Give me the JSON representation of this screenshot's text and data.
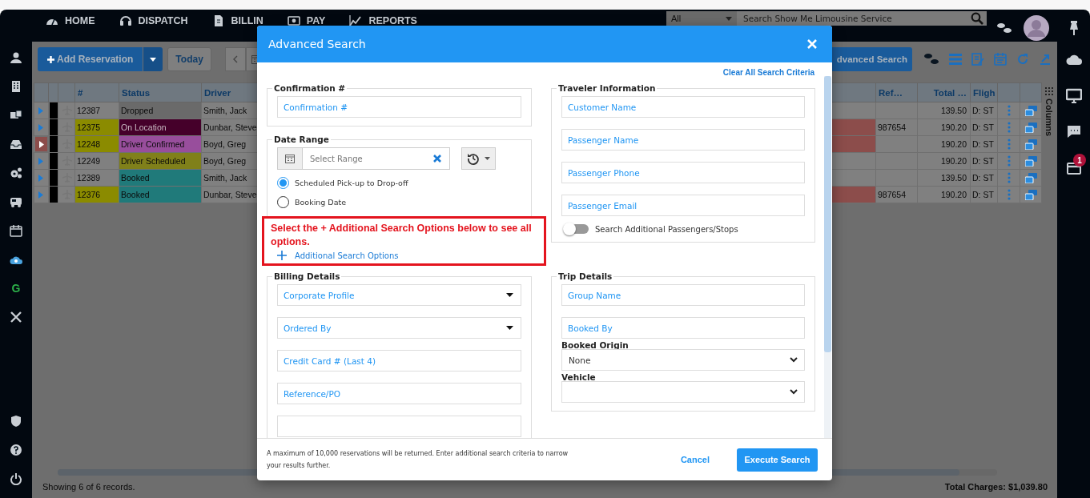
{
  "top_nav": {
    "items": [
      {
        "label": "HOME"
      },
      {
        "label": "DISPATCH"
      },
      {
        "label": "BILLIN"
      },
      {
        "label": "PAY"
      },
      {
        "label": "REPORTS"
      }
    ],
    "search": {
      "scope": "All",
      "placeholder": "Search Show Me Limousine Service"
    }
  },
  "left_sidebar": {
    "letter_item": "G"
  },
  "right_sidebar": {
    "badge": "1"
  },
  "toolbar": {
    "add_button": "Add Reservation",
    "today_button": "Today",
    "advanced_button": "dvanced Search"
  },
  "table": {
    "columns_left": [
      "#",
      "Status",
      "Driver"
    ],
    "columns_right": [
      "Ref…",
      "Total …",
      "Fligh"
    ],
    "side_tab": "Columns",
    "rows": [
      {
        "number": {
          "text": "12387"
        },
        "status": {
          "text": "Dropped",
          "color": "#6a6a6a"
        },
        "driver": "Smith, Jack",
        "alert": false,
        "selected": false,
        "total": "139.50",
        "flight": "D: ST"
      },
      {
        "number": {
          "text": "12375",
          "color": "#8b8b00"
        },
        "status": {
          "text": "On Location",
          "color": "#45002a"
        },
        "driver": "Dunbar, Steve",
        "alert": true,
        "selected": false,
        "ref": "987654",
        "total": "190.20",
        "flight": "D: ST"
      },
      {
        "number": {
          "text": "12248",
          "color": "#8b8b00"
        },
        "status": {
          "text": "Driver Confirmed",
          "color": "#984e9c"
        },
        "driver": "Boyd, Greg",
        "alert": true,
        "selected": true,
        "total": "190.20",
        "flight": "D: ST"
      },
      {
        "number": {
          "text": "12249"
        },
        "status": {
          "text": "Driver Scheduled",
          "color": "#80801a"
        },
        "driver": "Boyd, Greg",
        "alert": false,
        "selected": false,
        "total": "190.20",
        "flight": "D: ST"
      },
      {
        "number": {
          "text": "12389"
        },
        "status": {
          "text": "Booked",
          "color": "#207a7a"
        },
        "driver": "Smith, Jack",
        "alert": false,
        "selected": false,
        "total": "139.50",
        "flight": "D: ST"
      },
      {
        "number": {
          "text": "12376",
          "color": "#8b8b00"
        },
        "status": {
          "text": "Booked",
          "color": "#207a7a"
        },
        "driver": "Dunbar, Steve",
        "alert": true,
        "selected": false,
        "ref": "987654",
        "total": "190.20",
        "flight": "D: ST"
      }
    ]
  },
  "status_bar": {
    "records": "Showing 6 of 6 records.",
    "total": "Total Charges: $1,039.80"
  },
  "modal": {
    "title": "Advanced Search",
    "clear_link": "Clear All Search Criteria",
    "confirmation": {
      "legend": "Confirmation #",
      "placeholder": "Confirmation #"
    },
    "date_range": {
      "legend": "Date Range",
      "placeholder": "Select Range",
      "options": [
        {
          "label": "Scheduled Pick-up to Drop-off",
          "selected": true
        },
        {
          "label": "Booking Date",
          "selected": false
        }
      ]
    },
    "hint": {
      "message": "Select the + Additional Search Options below to see all options.",
      "link": "Additional Search Options"
    },
    "traveler": {
      "legend": "Traveler Information",
      "fields": [
        {
          "placeholder": "Customer Name"
        },
        {
          "placeholder": "Passenger Name"
        },
        {
          "placeholder": "Passenger Phone"
        },
        {
          "placeholder": "Passenger Email"
        }
      ],
      "toggle": {
        "label": "Search Additional Passengers/Stops",
        "on": false
      }
    },
    "billing": {
      "legend": "Billing Details",
      "fields": [
        {
          "kind": "select",
          "placeholder": "Corporate Profile"
        },
        {
          "kind": "select",
          "placeholder": "Ordered By"
        },
        {
          "kind": "input",
          "placeholder": "Credit Card # (Last 4)"
        },
        {
          "kind": "input",
          "placeholder": "Reference/PO"
        },
        {
          "kind": "input"
        }
      ]
    },
    "trip": {
      "legend": "Trip Details",
      "fields": [
        {
          "kind": "input",
          "placeholder": "Group Name"
        },
        {
          "kind": "input",
          "placeholder": "Booked By"
        },
        {
          "kind": "labeled-select",
          "label": "Booked Origin",
          "value": "None"
        },
        {
          "kind": "labeled-select",
          "label": "Vehicle"
        }
      ]
    },
    "footer": {
      "note": "A maximum of 10,000 reservations will be returned. Enter additional search criteria to narrow your results further.",
      "cancel": "Cancel",
      "execute": "Execute Search"
    }
  }
}
